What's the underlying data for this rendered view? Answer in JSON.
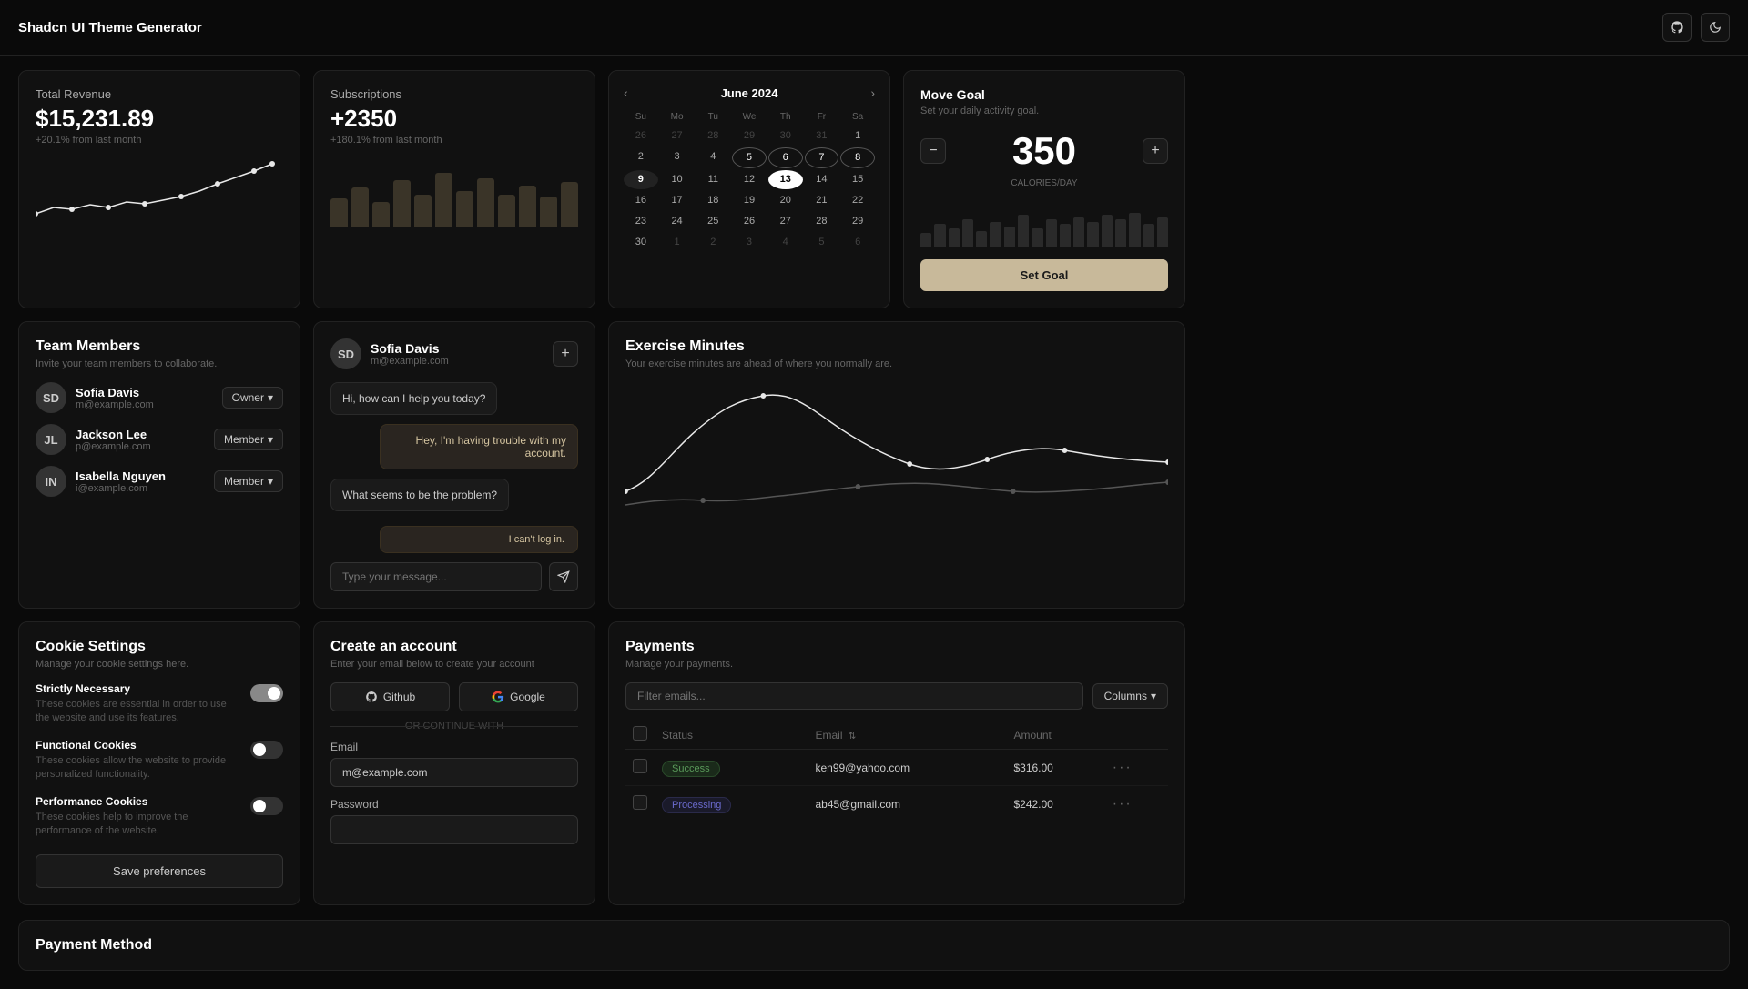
{
  "header": {
    "title": "Shadcn UI Theme Generator",
    "github_icon": "github-icon",
    "theme_icon": "theme-toggle-icon"
  },
  "revenue": {
    "title": "Total Revenue",
    "value": "$15,231.89",
    "change": "+20.1% from last month",
    "chart_points": [
      0,
      10,
      8,
      12,
      9,
      14,
      11,
      16,
      18,
      22,
      28,
      32,
      38,
      45
    ]
  },
  "subscriptions": {
    "title": "Subscriptions",
    "value": "+2350",
    "change": "+180.1% from last month",
    "bars": [
      40,
      55,
      35,
      60,
      45,
      70,
      50,
      65,
      45,
      55,
      40,
      60
    ]
  },
  "calendar": {
    "month": "June 2024",
    "prev_label": "‹",
    "next_label": "›",
    "day_labels": [
      "Su",
      "Mo",
      "Tu",
      "We",
      "Th",
      "Fr",
      "Sa"
    ],
    "days": [
      {
        "num": "26",
        "type": "prev"
      },
      {
        "num": "27",
        "type": "prev"
      },
      {
        "num": "28",
        "type": "prev"
      },
      {
        "num": "29",
        "type": "prev"
      },
      {
        "num": "30",
        "type": "prev"
      },
      {
        "num": "31",
        "type": "prev"
      },
      {
        "num": "1",
        "type": "normal"
      },
      {
        "num": "2",
        "type": "normal"
      },
      {
        "num": "3",
        "type": "normal"
      },
      {
        "num": "4",
        "type": "normal"
      },
      {
        "num": "5",
        "type": "highlighted"
      },
      {
        "num": "6",
        "type": "highlighted"
      },
      {
        "num": "7",
        "type": "highlighted"
      },
      {
        "num": "8",
        "type": "highlighted"
      },
      {
        "num": "9",
        "type": "today"
      },
      {
        "num": "10",
        "type": "normal"
      },
      {
        "num": "11",
        "type": "normal"
      },
      {
        "num": "12",
        "type": "normal"
      },
      {
        "num": "13",
        "type": "selected"
      },
      {
        "num": "14",
        "type": "normal"
      },
      {
        "num": "15",
        "type": "normal"
      },
      {
        "num": "16",
        "type": "normal"
      },
      {
        "num": "17",
        "type": "normal"
      },
      {
        "num": "18",
        "type": "normal"
      },
      {
        "num": "19",
        "type": "normal"
      },
      {
        "num": "20",
        "type": "normal"
      },
      {
        "num": "21",
        "type": "normal"
      },
      {
        "num": "22",
        "type": "normal"
      },
      {
        "num": "23",
        "type": "normal"
      },
      {
        "num": "24",
        "type": "normal"
      },
      {
        "num": "25",
        "type": "normal"
      },
      {
        "num": "26",
        "type": "normal"
      },
      {
        "num": "27",
        "type": "normal"
      },
      {
        "num": "28",
        "type": "normal"
      },
      {
        "num": "29",
        "type": "normal"
      },
      {
        "num": "30",
        "type": "normal"
      },
      {
        "num": "1",
        "type": "next"
      },
      {
        "num": "2",
        "type": "next"
      },
      {
        "num": "3",
        "type": "next"
      },
      {
        "num": "4",
        "type": "next"
      },
      {
        "num": "5",
        "type": "next"
      },
      {
        "num": "6",
        "type": "next"
      }
    ]
  },
  "move_goal": {
    "title": "Move Goal",
    "subtitle": "Set your daily activity goal.",
    "value": "350",
    "unit": "CALORIES/DAY",
    "minus_label": "−",
    "plus_label": "+",
    "set_goal_label": "Set Goal",
    "bars": [
      30,
      50,
      40,
      60,
      35,
      55,
      45,
      70,
      40,
      60,
      50,
      65,
      55,
      70,
      60,
      75,
      50,
      65
    ]
  },
  "team_members": {
    "title": "Team Members",
    "subtitle": "Invite your team members to collaborate.",
    "members": [
      {
        "name": "Sofia Davis",
        "email": "m@example.com",
        "role": "Owner",
        "initials": "SD"
      },
      {
        "name": "Jackson Lee",
        "email": "p@example.com",
        "role": "Member",
        "initials": "JL"
      },
      {
        "name": "Isabella Nguyen",
        "email": "i@example.com",
        "role": "Member",
        "initials": "IN"
      }
    ]
  },
  "chat": {
    "user_name": "Sofia Davis",
    "user_email": "m@example.com",
    "messages": [
      {
        "text": "Hi, how can I help you today?",
        "side": "left"
      },
      {
        "text": "Hey, I'm having trouble with my account.",
        "side": "right"
      },
      {
        "text": "What seems to be the problem?",
        "side": "left"
      },
      {
        "text": "I can't log in.",
        "side": "right2"
      }
    ],
    "input_placeholder": "Type your message...",
    "send_icon": "send-icon"
  },
  "create_account": {
    "title": "Create an account",
    "subtitle": "Enter your email below to create your account",
    "github_label": "Github",
    "google_label": "Google",
    "or_divider": "OR CONTINUE WITH",
    "email_label": "Email",
    "email_placeholder": "m@example.com",
    "password_label": "Password",
    "password_placeholder": ""
  },
  "cookie_settings": {
    "title": "Cookie Settings",
    "subtitle": "Manage your cookie settings here.",
    "cookies": [
      {
        "name": "Strictly Necessary",
        "desc": "These cookies are essential in order to use the website and use its features.",
        "enabled": true
      },
      {
        "name": "Functional Cookies",
        "desc": "These cookies allow the website to provide personalized functionality.",
        "enabled": false
      },
      {
        "name": "Performance Cookies",
        "desc": "These cookies help to improve the performance of the website.",
        "enabled": false
      }
    ],
    "save_label": "Save preferences"
  },
  "exercise": {
    "title": "Exercise Minutes",
    "subtitle": "Your exercise minutes are ahead of where you normally are.",
    "chart_points1": [
      10,
      20,
      15,
      40,
      35,
      30,
      20,
      25,
      30,
      20,
      15,
      25,
      20
    ],
    "chart_points2": [
      5,
      10,
      20,
      15,
      25,
      20,
      15,
      20,
      15,
      25,
      30,
      35,
      40
    ]
  },
  "payments": {
    "title": "Payments",
    "subtitle": "Manage your payments.",
    "filter_placeholder": "Filter emails...",
    "columns_label": "Columns",
    "headers": [
      "Status",
      "Email",
      "Amount"
    ],
    "rows": [
      {
        "status": "Success",
        "status_type": "success",
        "email": "ken99@yahoo.com",
        "amount": "$316.00"
      },
      {
        "status": "Processing",
        "status_type": "processing",
        "email": "ab45@gmail.com",
        "amount": "$242.00"
      }
    ]
  },
  "payment_method": {
    "title": "Payment Method"
  }
}
